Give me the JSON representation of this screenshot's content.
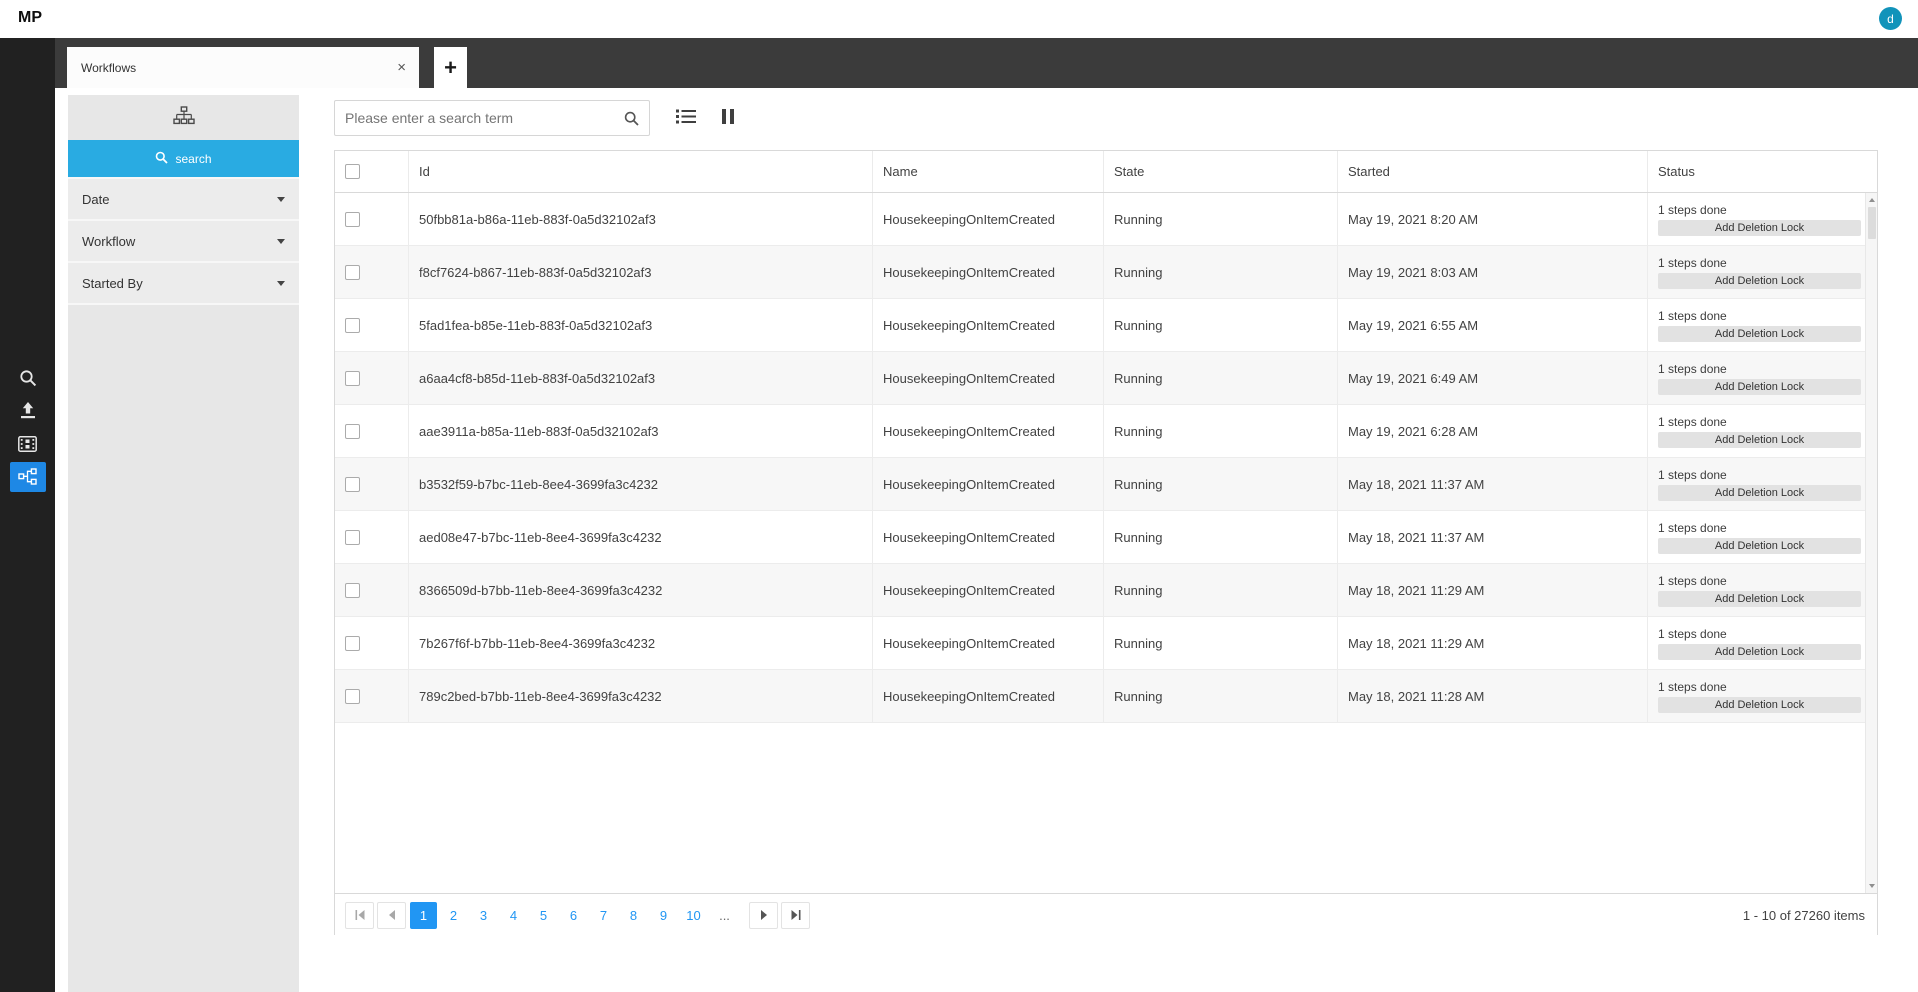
{
  "colors": {
    "accent_blue": "#2196f3",
    "search_button_blue": "#29abe2",
    "rail_active_blue": "#1e88e5",
    "avatar_teal": "#1193ba",
    "tab_bar_gray": "#3b3b3b",
    "rail_dark": "#212121",
    "panel_gray": "#e7e7e7"
  },
  "header": {
    "logo": "MP",
    "avatar_initial": "d"
  },
  "rail": {
    "items": [
      "search-icon",
      "upload-icon",
      "film-icon",
      "workflow-icon"
    ],
    "active": "workflow-icon"
  },
  "tabs": {
    "active_tab": "Workflows",
    "close_glyph": "×",
    "new_tab_glyph": "+"
  },
  "filter_panel": {
    "header_icon": "hierarchy-icon",
    "search_button": "search",
    "sections": [
      {
        "label": "Date"
      },
      {
        "label": "Workflow"
      },
      {
        "label": "Started By"
      }
    ]
  },
  "toolbar": {
    "search_placeholder": "Please enter a search term",
    "icons": [
      "search-icon",
      "list-icon",
      "pause-icon"
    ]
  },
  "grid": {
    "columns": [
      "Id",
      "Name",
      "State",
      "Started",
      "Status"
    ],
    "rows": [
      {
        "id": "50fbb81a-b86a-11eb-883f-0a5d32102af3",
        "name": "HousekeepingOnItemCreated",
        "state": "Running",
        "started": "May 19, 2021 8:20 AM",
        "steps": "1 steps done",
        "action": "Add Deletion Lock"
      },
      {
        "id": "f8cf7624-b867-11eb-883f-0a5d32102af3",
        "name": "HousekeepingOnItemCreated",
        "state": "Running",
        "started": "May 19, 2021 8:03 AM",
        "steps": "1 steps done",
        "action": "Add Deletion Lock"
      },
      {
        "id": "5fad1fea-b85e-11eb-883f-0a5d32102af3",
        "name": "HousekeepingOnItemCreated",
        "state": "Running",
        "started": "May 19, 2021 6:55 AM",
        "steps": "1 steps done",
        "action": "Add Deletion Lock"
      },
      {
        "id": "a6aa4cf8-b85d-11eb-883f-0a5d32102af3",
        "name": "HousekeepingOnItemCreated",
        "state": "Running",
        "started": "May 19, 2021 6:49 AM",
        "steps": "1 steps done",
        "action": "Add Deletion Lock"
      },
      {
        "id": "aae3911a-b85a-11eb-883f-0a5d32102af3",
        "name": "HousekeepingOnItemCreated",
        "state": "Running",
        "started": "May 19, 2021 6:28 AM",
        "steps": "1 steps done",
        "action": "Add Deletion Lock"
      },
      {
        "id": "b3532f59-b7bc-11eb-8ee4-3699fa3c4232",
        "name": "HousekeepingOnItemCreated",
        "state": "Running",
        "started": "May 18, 2021 11:37 AM",
        "steps": "1 steps done",
        "action": "Add Deletion Lock"
      },
      {
        "id": "aed08e47-b7bc-11eb-8ee4-3699fa3c4232",
        "name": "HousekeepingOnItemCreated",
        "state": "Running",
        "started": "May 18, 2021 11:37 AM",
        "steps": "1 steps done",
        "action": "Add Deletion Lock"
      },
      {
        "id": "8366509d-b7bb-11eb-8ee4-3699fa3c4232",
        "name": "HousekeepingOnItemCreated",
        "state": "Running",
        "started": "May 18, 2021 11:29 AM",
        "steps": "1 steps done",
        "action": "Add Deletion Lock"
      },
      {
        "id": "7b267f6f-b7bb-11eb-8ee4-3699fa3c4232",
        "name": "HousekeepingOnItemCreated",
        "state": "Running",
        "started": "May 18, 2021 11:29 AM",
        "steps": "1 steps done",
        "action": "Add Deletion Lock"
      },
      {
        "id": "789c2bed-b7bb-11eb-8ee4-3699fa3c4232",
        "name": "HousekeepingOnItemCreated",
        "state": "Running",
        "started": "May 18, 2021 11:28 AM",
        "steps": "1 steps done",
        "action": "Add Deletion Lock"
      }
    ]
  },
  "pager": {
    "pages": [
      "1",
      "2",
      "3",
      "4",
      "5",
      "6",
      "7",
      "8",
      "9",
      "10"
    ],
    "current": "1",
    "ellipsis": "...",
    "info": "1 - 10 of 27260 items"
  }
}
